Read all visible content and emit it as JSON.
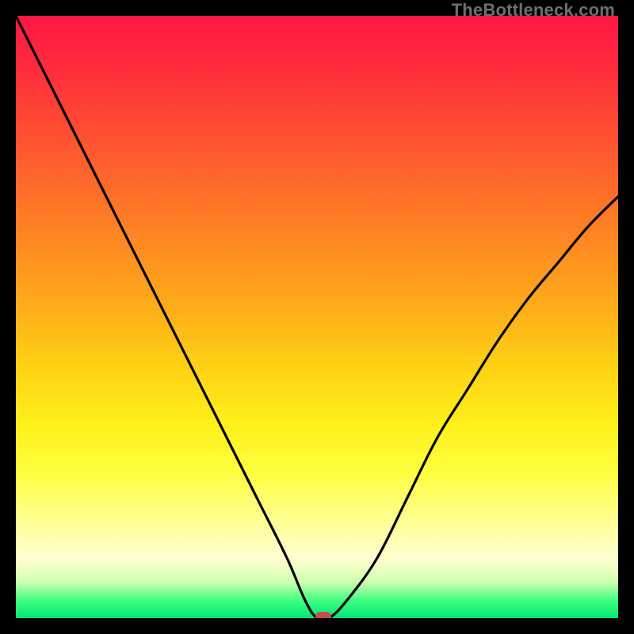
{
  "watermark": "TheBottleneck.com",
  "colors": {
    "frame": "#000000",
    "curve": "#000000",
    "marker": "#c0504d",
    "gradient_top": "#ff1744",
    "gradient_mid": "#ffd014",
    "gradient_bottom": "#00e676"
  },
  "chart_data": {
    "type": "line",
    "title": "",
    "xlabel": "",
    "ylabel": "",
    "xlim": [
      0,
      100
    ],
    "ylim": [
      0,
      100
    ],
    "grid": false,
    "legend": false,
    "series": [
      {
        "name": "bottleneck-curve",
        "x": [
          0,
          5,
          10,
          15,
          20,
          25,
          30,
          35,
          40,
          45,
          48,
          50,
          52,
          55,
          60,
          65,
          70,
          75,
          80,
          85,
          90,
          95,
          100
        ],
        "y": [
          100,
          90,
          80,
          70,
          60,
          50,
          40,
          30,
          20,
          10,
          3,
          0,
          0,
          3,
          10,
          20,
          30,
          38,
          46,
          53,
          59,
          65,
          70
        ]
      }
    ],
    "marker": {
      "x": 51,
      "y": 0,
      "label": ""
    }
  }
}
